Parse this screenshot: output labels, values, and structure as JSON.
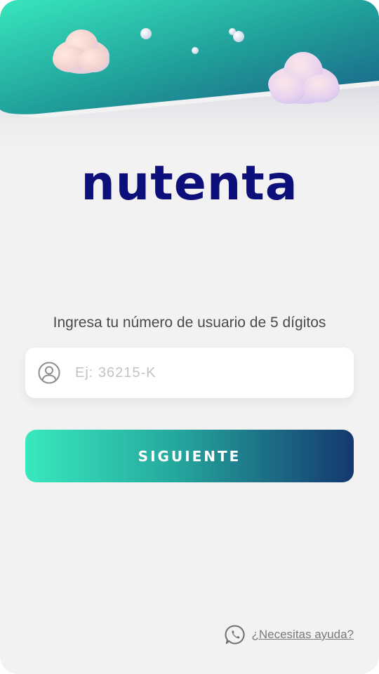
{
  "app": {
    "logo_text": "nutenta"
  },
  "login": {
    "prompt": "Ingresa tu número de usuario de 5 dígitos",
    "user_input": {
      "placeholder": "Ej: 36215-K",
      "value": "",
      "icon": "user-icon"
    },
    "next_button_label": "SIGUIENTE"
  },
  "help": {
    "icon": "whatsapp-icon",
    "link_text": "¿Necesitas ayuda?"
  },
  "colors": {
    "logo": "#0d0f7a",
    "gradient_start": "#39e8bd",
    "gradient_end": "#14386f",
    "background": "#f2f2f3"
  }
}
